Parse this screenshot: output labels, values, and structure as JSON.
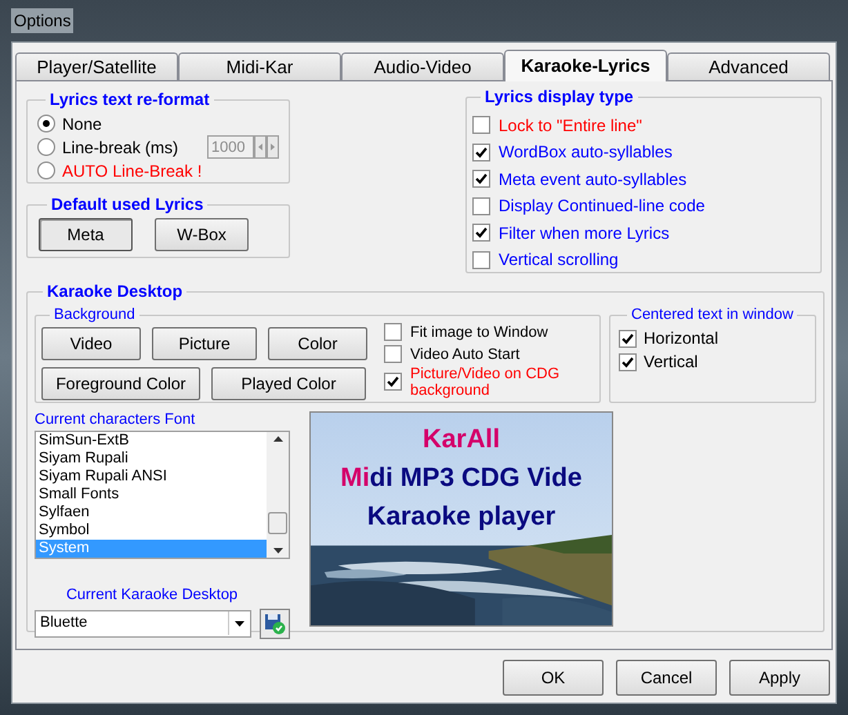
{
  "window": {
    "title": "Options"
  },
  "tabs": [
    {
      "label": "Player/Satellite",
      "selected": false
    },
    {
      "label": "Midi-Kar",
      "selected": false
    },
    {
      "label": "Audio-Video",
      "selected": false
    },
    {
      "label": "Karaoke-Lyrics",
      "selected": true
    },
    {
      "label": "Advanced",
      "selected": false
    }
  ],
  "lyrics_reformat": {
    "title": "Lyrics text re-format",
    "options": [
      {
        "label": "None",
        "selected": true,
        "emphasis": false
      },
      {
        "label": "Line-break (ms)",
        "selected": false,
        "emphasis": false
      },
      {
        "label": "AUTO Line-Break !",
        "selected": false,
        "emphasis": true
      }
    ],
    "line_break": {
      "value": "1000",
      "disabled": true
    }
  },
  "default_lyrics": {
    "title": "Default used Lyrics",
    "buttons": [
      {
        "label": "Meta",
        "selected": true
      },
      {
        "label": "W-Box",
        "selected": false
      }
    ]
  },
  "lyrics_display": {
    "title": "Lyrics display type",
    "options": [
      {
        "label": "Lock to \"Entire line\"",
        "checked": false,
        "emphasis": true
      },
      {
        "label": "WordBox auto-syllables",
        "checked": true,
        "emphasis": false
      },
      {
        "label": "Meta event auto-syllables",
        "checked": true,
        "emphasis": false
      },
      {
        "label": "Display Continued-line code",
        "checked": false,
        "emphasis": false
      },
      {
        "label": "Filter when more Lyrics",
        "checked": true,
        "emphasis": false
      },
      {
        "label": "Vertical scrolling",
        "checked": false,
        "emphasis": false
      }
    ]
  },
  "karaoke_desktop": {
    "title": "Karaoke Desktop",
    "background": {
      "title": "Background",
      "button_rows": [
        [
          "Video",
          "Picture",
          "Color"
        ],
        [
          "Foreground Color",
          "Played Color"
        ]
      ],
      "options": [
        {
          "label": "Fit image to Window",
          "checked": false,
          "emphasis": false
        },
        {
          "label": "Video Auto Start",
          "checked": false,
          "emphasis": false
        },
        {
          "label": "Picture/Video on CDG background",
          "checked": true,
          "emphasis": true
        }
      ]
    },
    "centered": {
      "title": "Centered text in window",
      "options": [
        {
          "label": "Horizontal",
          "checked": true
        },
        {
          "label": "Vertical",
          "checked": true
        }
      ]
    },
    "font": {
      "label": "Current characters Font",
      "items": [
        {
          "label": "SimSun-ExtB",
          "selected": false
        },
        {
          "label": "Siyam Rupali",
          "selected": false
        },
        {
          "label": "Siyam Rupali ANSI",
          "selected": false
        },
        {
          "label": "Small Fonts",
          "selected": false
        },
        {
          "label": "Sylfaen",
          "selected": false
        },
        {
          "label": "Symbol",
          "selected": false
        },
        {
          "label": "System",
          "selected": true
        }
      ]
    },
    "desktop": {
      "label": "Current Karaoke Desktop",
      "value": "Bluette"
    },
    "preview": {
      "lines": [
        [
          {
            "text": "KarAll",
            "played": true
          }
        ],
        [
          {
            "text": "Mi",
            "played": true
          },
          {
            "text": "di MP3 CDG Vide",
            "played": false
          }
        ],
        [
          {
            "text": "Karaoke player",
            "played": false
          }
        ]
      ]
    }
  },
  "buttons": [
    "OK",
    "Cancel",
    "Apply"
  ]
}
